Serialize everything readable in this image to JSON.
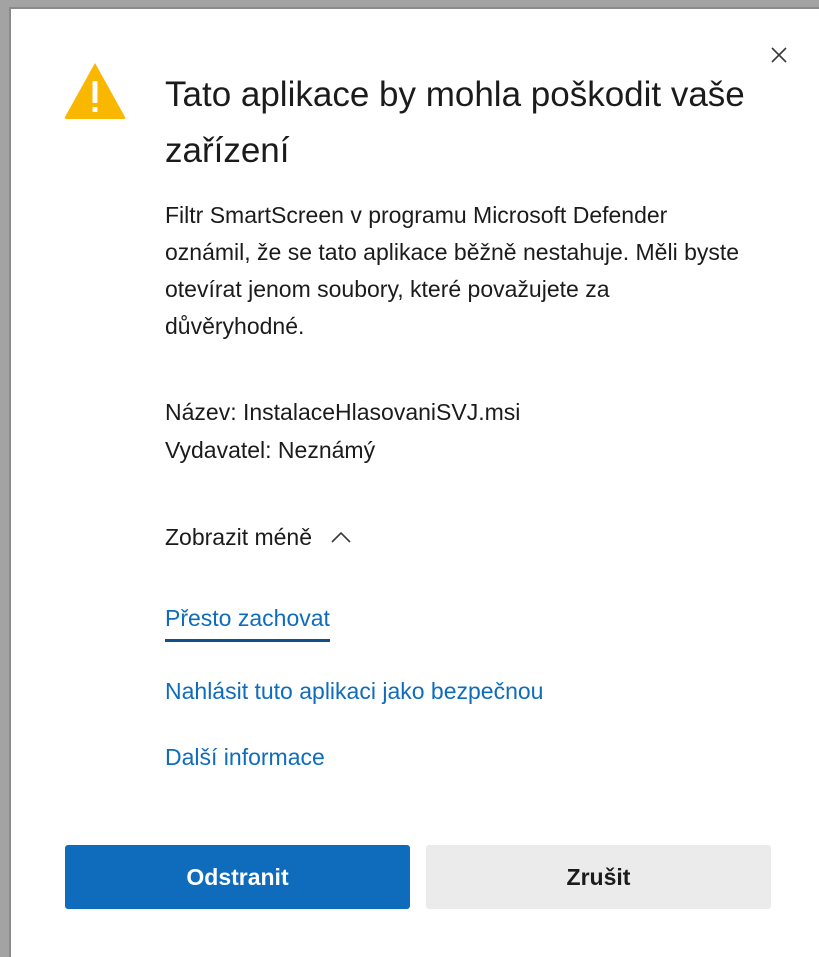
{
  "dialog": {
    "title": "Tato aplikace by mohla poškodit vaše zařízení",
    "description": "Filtr SmartScreen v programu Microsoft Defender oznámil, že se tato aplikace běžně nestahuje. Měli byste otevírat jenom soubory, které považujete za důvěryhodné.",
    "file_name": "Název: InstalaceHlasovaniSVJ.msi",
    "publisher": "Vydavatel: Neznámý",
    "toggle_label": "Zobrazit méně",
    "links": {
      "keep": "Přesto zachovat",
      "report": "Nahlásit tuto aplikaci jako bezpečnou",
      "more_info": "Další informace"
    },
    "buttons": {
      "delete": "Odstranit",
      "cancel": "Zrušit"
    },
    "icons": {
      "warning": "warning-icon",
      "close": "close-icon",
      "chevron": "chevron-up-icon"
    },
    "colors": {
      "accent": "#0f6cbd",
      "warning": "#f9b700"
    }
  }
}
